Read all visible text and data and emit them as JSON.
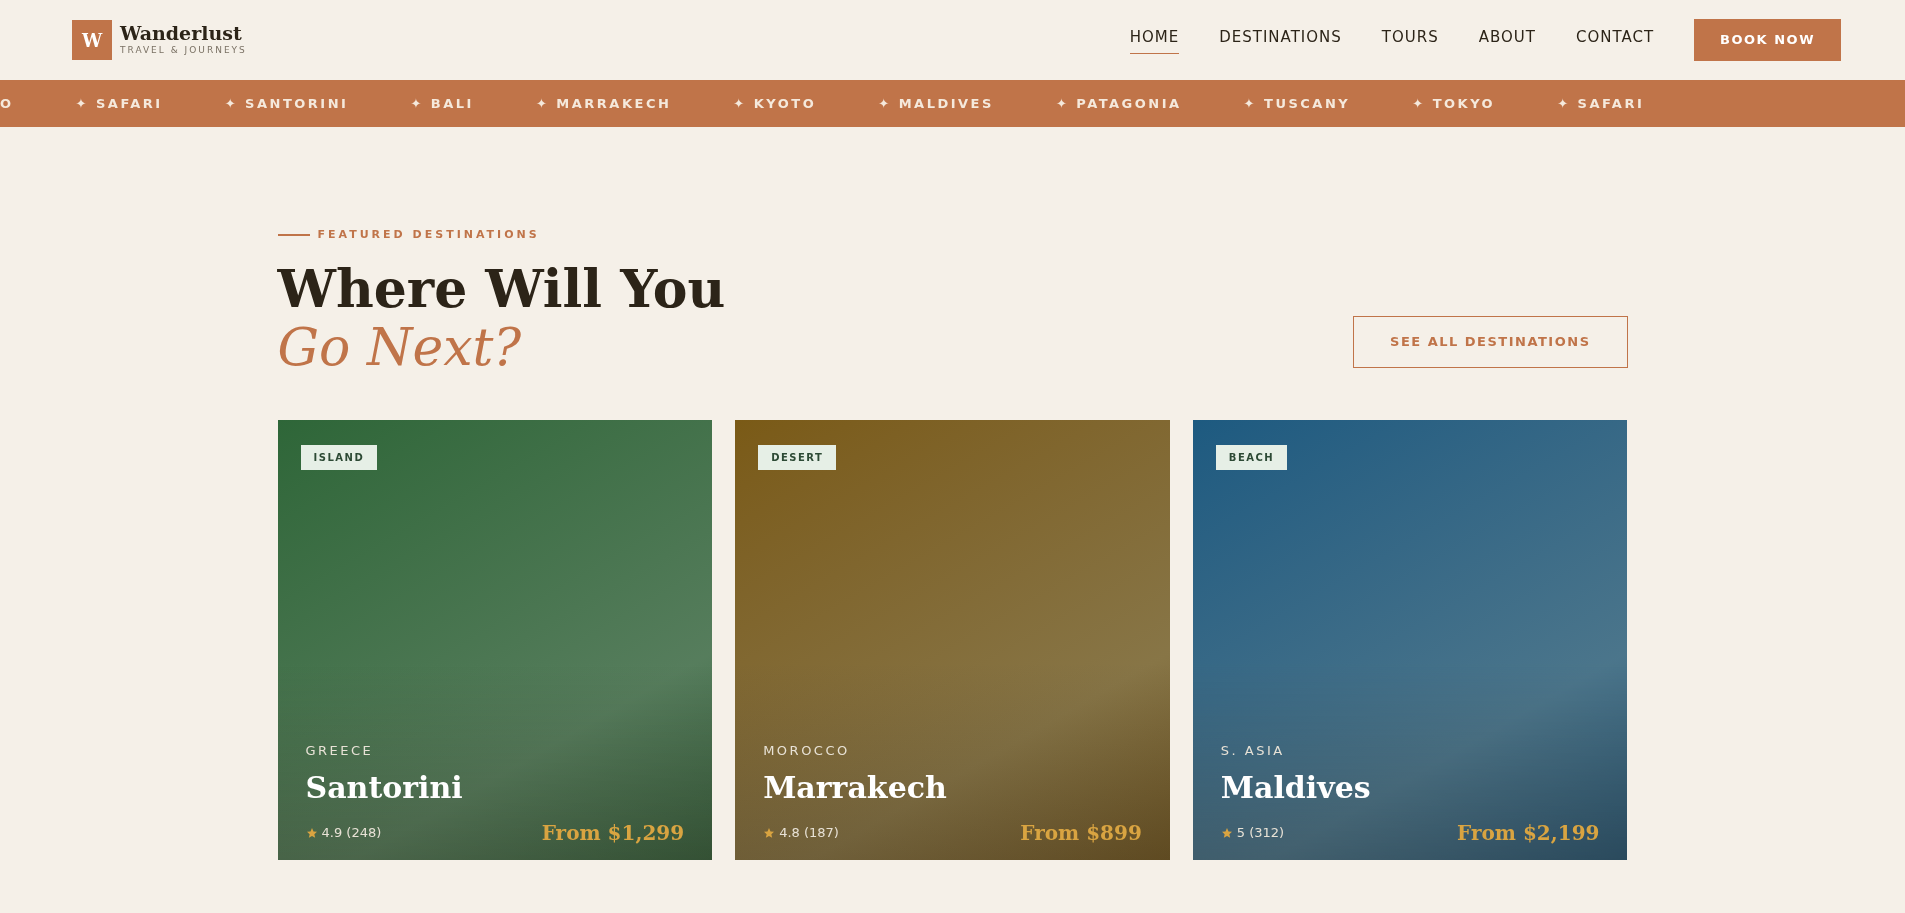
{
  "brand": {
    "mark": "W",
    "name": "Wanderlust",
    "tagline": "TRAVEL & JOURNEYS"
  },
  "nav": [
    {
      "label": "HOME",
      "selected": true
    },
    {
      "label": "DESTINATIONS",
      "selected": false
    },
    {
      "label": "TOURS",
      "selected": false
    },
    {
      "label": "ABOUT",
      "selected": false
    },
    {
      "label": "CONTACT",
      "selected": false
    }
  ],
  "cta_button": "BOOK NOW",
  "ticker": [
    {
      "label": "O"
    },
    {
      "icon": "✦",
      "label": "SAFARI"
    },
    {
      "icon": "✦",
      "label": "SANTORINI"
    },
    {
      "icon": "✦",
      "label": "BALI"
    },
    {
      "icon": "✦",
      "label": "MARRAKECH"
    },
    {
      "icon": "✦",
      "label": "KYOTO"
    },
    {
      "icon": "✦",
      "label": "MALDIVES"
    },
    {
      "icon": "✦",
      "label": "PATAGONIA"
    },
    {
      "icon": "✦",
      "label": "TUSCANY"
    },
    {
      "icon": "✦",
      "label": "TOKYO"
    },
    {
      "icon": "✦",
      "label": "SAFARI"
    }
  ],
  "section": {
    "eyebrow": "FEATURED DESTINATIONS",
    "heading": "Where Will You",
    "heading_accent": "Go Next?",
    "link_button": "SEE ALL DESTINATIONS"
  },
  "cards": [
    {
      "tag": "ISLAND",
      "country": "GREECE",
      "name": "Santorini",
      "rating": "4.9 (248)",
      "price": "From $1,299",
      "color": "#2e6638"
    },
    {
      "tag": "DESERT",
      "country": "MOROCCO",
      "name": "Marrakech",
      "rating": "4.8 (187)",
      "price": "From $899",
      "color": "#7a5a16"
    },
    {
      "tag": "BEACH",
      "country": "S. ASIA",
      "name": "Maldives",
      "rating": "5 (312)",
      "price": "From $2,199",
      "color": "#1d5a80"
    }
  ]
}
